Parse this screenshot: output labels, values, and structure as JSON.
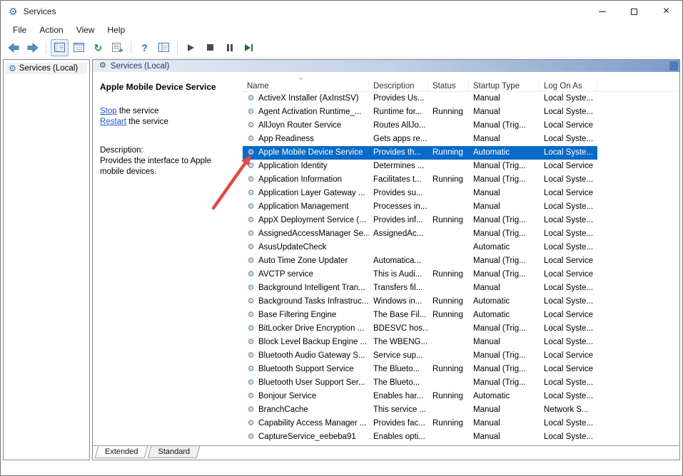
{
  "window": {
    "title": "Services"
  },
  "menu": {
    "items": [
      "File",
      "Action",
      "View",
      "Help"
    ]
  },
  "toolbar": {
    "buttons": [
      "back",
      "forward",
      "show-hide-console-tree",
      "properties",
      "refresh",
      "export-list",
      "help",
      "extended-view",
      "start-service",
      "stop-service",
      "pause-service",
      "restart-service"
    ]
  },
  "left_pane": {
    "root_label": "Services (Local)"
  },
  "banner": {
    "title": "Services (Local)"
  },
  "info_panel": {
    "service_name": "Apple Mobile Device Service",
    "stop_link": "Stop",
    "stop_suffix": " the service",
    "restart_link": "Restart",
    "restart_suffix": " the service",
    "description_label": "Description:",
    "description_text": "Provides the interface to Apple mobile devices."
  },
  "table": {
    "columns": [
      "Name",
      "Description",
      "Status",
      "Startup Type",
      "Log On As"
    ],
    "sort_indicator": "^",
    "rows": [
      {
        "name": "ActiveX Installer (AxInstSV)",
        "desc": "Provides Us...",
        "status": "",
        "startup": "Manual",
        "logon": "Local Syste...",
        "selected": false
      },
      {
        "name": "Agent Activation Runtime_...",
        "desc": "Runtime for...",
        "status": "Running",
        "startup": "Manual",
        "logon": "Local Syste...",
        "selected": false
      },
      {
        "name": "AllJoyn Router Service",
        "desc": "Routes AllJo...",
        "status": "",
        "startup": "Manual (Trig...",
        "logon": "Local Service",
        "selected": false
      },
      {
        "name": "App Readiness",
        "desc": "Gets apps re...",
        "status": "",
        "startup": "Manual",
        "logon": "Local Syste...",
        "selected": false
      },
      {
        "name": "Apple Mobile Device Service",
        "desc": "Provides th...",
        "status": "Running",
        "startup": "Automatic",
        "logon": "Local Syste...",
        "selected": true
      },
      {
        "name": "Application Identity",
        "desc": "Determines ...",
        "status": "",
        "startup": "Manual (Trig...",
        "logon": "Local Service",
        "selected": false
      },
      {
        "name": "Application Information",
        "desc": "Facilitates t...",
        "status": "Running",
        "startup": "Manual (Trig...",
        "logon": "Local Syste...",
        "selected": false
      },
      {
        "name": "Application Layer Gateway ...",
        "desc": "Provides su...",
        "status": "",
        "startup": "Manual",
        "logon": "Local Service",
        "selected": false
      },
      {
        "name": "Application Management",
        "desc": "Processes in...",
        "status": "",
        "startup": "Manual",
        "logon": "Local Syste...",
        "selected": false
      },
      {
        "name": "AppX Deployment Service (...",
        "desc": "Provides inf...",
        "status": "Running",
        "startup": "Manual (Trig...",
        "logon": "Local Syste...",
        "selected": false
      },
      {
        "name": "AssignedAccessManager Se...",
        "desc": "AssignedAc...",
        "status": "",
        "startup": "Manual (Trig...",
        "logon": "Local Syste...",
        "selected": false
      },
      {
        "name": "AsusUpdateCheck",
        "desc": "",
        "status": "",
        "startup": "Automatic",
        "logon": "Local Syste...",
        "selected": false
      },
      {
        "name": "Auto Time Zone Updater",
        "desc": "Automatica...",
        "status": "",
        "startup": "Manual (Trig...",
        "logon": "Local Service",
        "selected": false
      },
      {
        "name": "AVCTP service",
        "desc": "This is Audi...",
        "status": "Running",
        "startup": "Manual (Trig...",
        "logon": "Local Service",
        "selected": false
      },
      {
        "name": "Background Intelligent Tran...",
        "desc": "Transfers fil...",
        "status": "",
        "startup": "Manual",
        "logon": "Local Syste...",
        "selected": false
      },
      {
        "name": "Background Tasks Infrastruc...",
        "desc": "Windows in...",
        "status": "Running",
        "startup": "Automatic",
        "logon": "Local Syste...",
        "selected": false
      },
      {
        "name": "Base Filtering Engine",
        "desc": "The Base Fil...",
        "status": "Running",
        "startup": "Automatic",
        "logon": "Local Service",
        "selected": false
      },
      {
        "name": "BitLocker Drive Encryption ...",
        "desc": "BDESVC hos...",
        "status": "",
        "startup": "Manual (Trig...",
        "logon": "Local Syste...",
        "selected": false
      },
      {
        "name": "Block Level Backup Engine ...",
        "desc": "The WBENG...",
        "status": "",
        "startup": "Manual",
        "logon": "Local Syste...",
        "selected": false
      },
      {
        "name": "Bluetooth Audio Gateway S...",
        "desc": "Service sup...",
        "status": "",
        "startup": "Manual (Trig...",
        "logon": "Local Service",
        "selected": false
      },
      {
        "name": "Bluetooth Support Service",
        "desc": "The Blueto...",
        "status": "Running",
        "startup": "Manual (Trig...",
        "logon": "Local Service",
        "selected": false
      },
      {
        "name": "Bluetooth User Support Ser...",
        "desc": "The Blueto...",
        "status": "",
        "startup": "Manual (Trig...",
        "logon": "Local Syste...",
        "selected": false
      },
      {
        "name": "Bonjour Service",
        "desc": "Enables har...",
        "status": "Running",
        "startup": "Automatic",
        "logon": "Local Syste...",
        "selected": false
      },
      {
        "name": "BranchCache",
        "desc": "This service ...",
        "status": "",
        "startup": "Manual",
        "logon": "Network S...",
        "selected": false
      },
      {
        "name": "Capability Access Manager ...",
        "desc": "Provides fac...",
        "status": "Running",
        "startup": "Manual",
        "logon": "Local Syste...",
        "selected": false
      },
      {
        "name": "CaptureService_eebeba91",
        "desc": "Enables opti...",
        "status": "",
        "startup": "Manual",
        "logon": "Local Syste...",
        "selected": false
      }
    ]
  },
  "tabs": [
    {
      "label": "Extended",
      "active": true
    },
    {
      "label": "Standard",
      "active": false
    }
  ],
  "icons": {
    "app_gear": "⚙",
    "tree_gear": "⚙",
    "banner_gear": "⚙",
    "service_gear": "⚙",
    "refresh_glyph": "↻",
    "help_glyph": "?",
    "close_glyph": "×"
  },
  "colors": {
    "selection": "#0a6ac6",
    "link": "#2056c7",
    "arrow_red": "#e04a3f"
  }
}
